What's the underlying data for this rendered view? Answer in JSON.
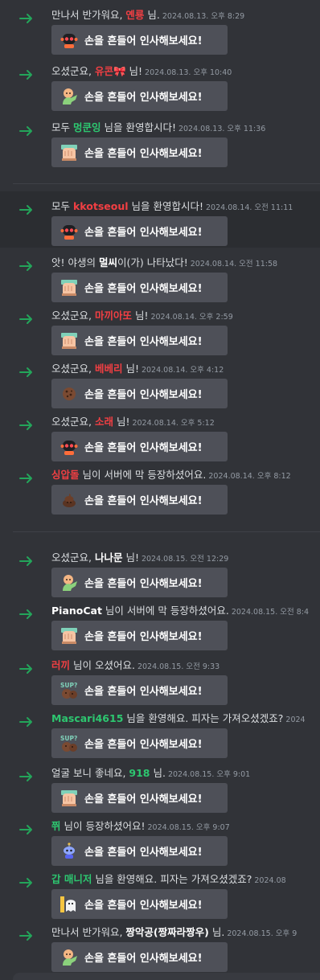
{
  "wave_button_label": "손을 흔들어 인사해보세요!",
  "colors": {
    "background": "#313338",
    "join_arrow": "#23a55a",
    "button_bg": "#4e5058",
    "timestamp": "#949ba4"
  },
  "messages": [
    {
      "pre": "만나서 반가워요, ",
      "name": "옌룡",
      "name_color": "#f23f43",
      "post": " 님.",
      "time": "2024.08.13. 오후 8:29",
      "sticker": "robot-sticker-icon"
    },
    {
      "pre": "오셨군요, ",
      "name": "유콘🎀",
      "name_color": "#f23f43",
      "post": " 님!",
      "time": "2024.08.13. 오후 10:40",
      "sticker": "wumpus-wave-sticker-icon"
    },
    {
      "pre": "모두 ",
      "name": "멍쿤잉",
      "name_color": "#2dc770",
      "post": " 님을 환영합시다!",
      "time": "2024.08.13. 오후 11:36",
      "sticker": "hand-wave-sticker-icon"
    },
    {
      "pre": "모두 ",
      "name": "kkotseoul",
      "name_color": "#f23f43",
      "post": " 님을 환영합시다!",
      "time": "2024.08.14. 오전 11:11",
      "sticker": "robot-sticker-icon"
    },
    {
      "pre": "앗! 야생의 ",
      "name": "멀씨",
      "name_color": "#ffffff",
      "post": "이(가) 나타났다!",
      "time": "2024.08.14. 오전 11:58",
      "sticker": "hand-wave-sticker-icon"
    },
    {
      "pre": "오셨군요, ",
      "name": "마끼아또",
      "name_color": "#f23f43",
      "post": " 님!",
      "time": "2024.08.14. 오후 2:59",
      "sticker": "hand-wave-sticker-icon"
    },
    {
      "pre": "오셨군요, ",
      "name": "베베리",
      "name_color": "#f23f43",
      "post": " 님!",
      "time": "2024.08.14. 오후 4:12",
      "sticker": "cookie-sticker-icon"
    },
    {
      "pre": "오셨군요, ",
      "name": "소래",
      "name_color": "#f23f43",
      "post": " 님!",
      "time": "2024.08.14. 오후 5:12",
      "sticker": "robot-sticker-icon"
    },
    {
      "pre": "",
      "name": "싱압돌",
      "name_color": "#f23f43",
      "post": " 님이 서버에 막 등장하셨어요.",
      "time": "2024.08.14. 오후 8:12",
      "sticker": "poop-sticker-icon"
    },
    {
      "pre": "오셨군요, ",
      "name": "나나문",
      "name_color": "#ffffff",
      "post": " 님!",
      "time": "2024.08.15. 오전 12:29",
      "sticker": "wumpus-wave-sticker-icon"
    },
    {
      "pre": "",
      "name": "PianoCat",
      "name_color": "#ffffff",
      "post": " 님이 서버에 막 등장하셨어요.",
      "time": "2024.08.15. 오전 8:4",
      "sticker": "hand-wave-sticker-icon"
    },
    {
      "pre": "",
      "name": "러끼",
      "name_color": "#f23f43",
      "post": " 님이 오셨어요.",
      "time": "2024.08.15. 오전 9:33",
      "sticker": "sup-sticker-icon"
    },
    {
      "pre": "",
      "name": "Mascari4615",
      "name_color": "#2dc770",
      "post": " 님을 환영해요. 피자는 가져오셨겠죠?",
      "time": "2024",
      "sticker": "sup-sticker-icon"
    },
    {
      "pre": "얼굴 보니 좋네요, ",
      "name": "918",
      "name_color": "#2dc770",
      "post": " 님.",
      "time": "2024.08.15. 오후 9:01",
      "sticker": "hand-wave-sticker-icon"
    },
    {
      "pre": "",
      "name": "쮜",
      "name_color": "#2dc770",
      "post": " 님이 등장하셨어요!",
      "time": "2024.08.15. 오후 9:07",
      "sticker": "blue-robot-sticker-icon"
    },
    {
      "pre": "",
      "name": "갑 매니저",
      "name_color": "#2dc770",
      "post": " 님을 환영해요. 피자는 가져오셨겠죠?",
      "time": "2024.08",
      "sticker": "ghost-sticker-icon"
    },
    {
      "pre": "만나서 반가워요, ",
      "name": "짱악공(짱짜라짱우)",
      "name_color": "#ffffff",
      "post": " 님.",
      "time": "2024.08.15. 오후 9",
      "sticker": "wumpus-wave-sticker-icon"
    }
  ]
}
